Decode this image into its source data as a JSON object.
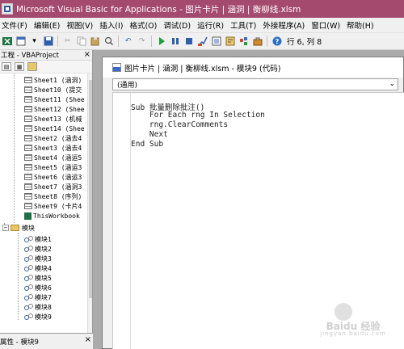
{
  "window": {
    "title": "Microsoft Visual Basic for Applications - 图片卡片 | 涵洞 | 衡柳线.xlsm"
  },
  "menu": [
    "文件(F)",
    "编辑(E)",
    "视图(V)",
    "插入(I)",
    "格式(O)",
    "调试(D)",
    "运行(R)",
    "工具(T)",
    "外接程序(A)",
    "窗口(W)",
    "帮助(H)"
  ],
  "toolbar": {
    "position_text": "行 6, 列 8"
  },
  "project_explorer": {
    "title": "工程 - VBAProject",
    "sheets": [
      "Sheet1 (涵洞)",
      "Sheet10 (提交",
      "Sheet11 (Shee",
      "Sheet12 (Shee",
      "Sheet13 (机械",
      "Sheet14 (Shee",
      "Sheet2 (涵去4",
      "Sheet3 (涵去4",
      "Sheet4 (涵运5",
      "Sheet5 (涵运3",
      "Sheet6 (涵运3",
      "Sheet7 (涵洞3",
      "Sheet8 (序列)",
      "Sheet9 (卡片4"
    ],
    "workbook_item": "ThisWorkbook",
    "modules_folder": "模块",
    "modules": [
      "模块1",
      "模块2",
      "模块3",
      "模块4",
      "模块5",
      "模块6",
      "模块7",
      "模块8",
      "模块9"
    ]
  },
  "properties_pane": {
    "title": "属性 - 模块9"
  },
  "code_window": {
    "title": "图片卡片 | 涵洞 | 衡柳线.xlsm - 模块9 (代码)",
    "object_combo": "(通用)",
    "lines": [
      "Sub 批量删除批注()",
      "    For Each rng In Selection",
      "    rng.ClearComments",
      "    Next",
      "End Sub"
    ]
  },
  "watermark": {
    "brand": "Baidu 经验",
    "url": "jingyan.baidu.com"
  }
}
